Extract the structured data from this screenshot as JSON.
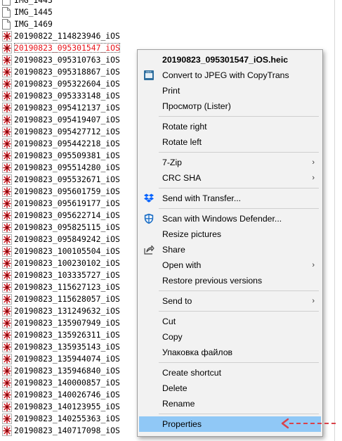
{
  "files": [
    {
      "name": "IMG_1443",
      "icon": "doc-icon"
    },
    {
      "name": "IMG_1445",
      "icon": "doc-icon"
    },
    {
      "name": "IMG_1469",
      "icon": "doc-icon"
    },
    {
      "name": "20190822_114823946_iOS",
      "icon": "heic-icon"
    },
    {
      "name": "20190823_095301547_iOS",
      "icon": "heic-icon",
      "selected": true
    },
    {
      "name": "20190823_095310763_iOS",
      "icon": "heic-icon"
    },
    {
      "name": "20190823_095318867_iOS",
      "icon": "heic-icon"
    },
    {
      "name": "20190823_095322604_iOS",
      "icon": "heic-icon"
    },
    {
      "name": "20190823_095333148_iOS",
      "icon": "heic-icon"
    },
    {
      "name": "20190823_095412137_iOS",
      "icon": "heic-icon"
    },
    {
      "name": "20190823_095419407_iOS",
      "icon": "heic-icon"
    },
    {
      "name": "20190823_095427712_iOS",
      "icon": "heic-icon"
    },
    {
      "name": "20190823_095442218_iOS",
      "icon": "heic-icon"
    },
    {
      "name": "20190823_095509381_iOS",
      "icon": "heic-icon"
    },
    {
      "name": "20190823_095514280_iOS",
      "icon": "heic-icon"
    },
    {
      "name": "20190823_095532671_iOS",
      "icon": "heic-icon"
    },
    {
      "name": "20190823_095601759_iOS",
      "icon": "heic-icon"
    },
    {
      "name": "20190823_095619177_iOS",
      "icon": "heic-icon"
    },
    {
      "name": "20190823_095622714_iOS",
      "icon": "heic-icon"
    },
    {
      "name": "20190823_095825115_iOS",
      "icon": "heic-icon"
    },
    {
      "name": "20190823_095849242_iOS",
      "icon": "heic-icon"
    },
    {
      "name": "20190823_100105504_iOS",
      "icon": "heic-icon"
    },
    {
      "name": "20190823_100230102_iOS",
      "icon": "heic-icon"
    },
    {
      "name": "20190823_103335727_iOS",
      "icon": "heic-icon"
    },
    {
      "name": "20190823_115627123_iOS",
      "icon": "heic-icon"
    },
    {
      "name": "20190823_115628057_iOS",
      "icon": "heic-icon"
    },
    {
      "name": "20190823_131249632_iOS",
      "icon": "heic-icon"
    },
    {
      "name": "20190823_135907949_iOS",
      "icon": "heic-icon"
    },
    {
      "name": "20190823_135926311_iOS",
      "icon": "heic-icon"
    },
    {
      "name": "20190823_135935143_iOS",
      "icon": "heic-icon"
    },
    {
      "name": "20190823_135944074_iOS",
      "icon": "heic-icon"
    },
    {
      "name": "20190823_135946840_iOS",
      "icon": "heic-icon"
    },
    {
      "name": "20190823_140000857_iOS",
      "icon": "heic-icon"
    },
    {
      "name": "20190823_140026746_iOS",
      "icon": "heic-icon"
    },
    {
      "name": "20190823_140123955_iOS",
      "icon": "heic-icon"
    },
    {
      "name": "20190823_140255363_iOS",
      "icon": "heic-icon"
    },
    {
      "name": "20190823_140717098_iOS",
      "icon": "heic-icon"
    }
  ],
  "menu": {
    "header": "20190823_095301547_iOS.heic",
    "items": [
      {
        "label": "Convert to JPEG with CopyTrans",
        "icon": "copytrans-heic-icon"
      },
      {
        "label": "Print"
      },
      {
        "label": "Просмотр (Lister)"
      },
      {
        "separator": true
      },
      {
        "label": "Rotate right"
      },
      {
        "label": "Rotate left"
      },
      {
        "separator": true
      },
      {
        "label": "7-Zip",
        "submenu": true
      },
      {
        "label": "CRC SHA",
        "submenu": true
      },
      {
        "separator": true
      },
      {
        "label": "Send with Transfer...",
        "icon": "dropbox-icon"
      },
      {
        "separator": true
      },
      {
        "label": "Scan with Windows Defender...",
        "icon": "windows-defender-icon"
      },
      {
        "label": "Resize pictures"
      },
      {
        "label": "Share",
        "icon": "share-icon"
      },
      {
        "label": "Open with",
        "submenu": true
      },
      {
        "label": "Restore previous versions"
      },
      {
        "separator": true
      },
      {
        "label": "Send to",
        "submenu": true
      },
      {
        "separator": true
      },
      {
        "label": "Cut"
      },
      {
        "label": "Copy"
      },
      {
        "label": "Упаковка файлов"
      },
      {
        "separator": true
      },
      {
        "label": "Create shortcut"
      },
      {
        "label": "Delete"
      },
      {
        "label": "Rename"
      },
      {
        "separator": true
      },
      {
        "label": "Properties",
        "highlighted": true
      }
    ],
    "submenu_glyph": "›"
  },
  "colors": {
    "selected_text": "#e8141a",
    "highlight": "#90c8f6",
    "arrow": "#d9434b"
  }
}
